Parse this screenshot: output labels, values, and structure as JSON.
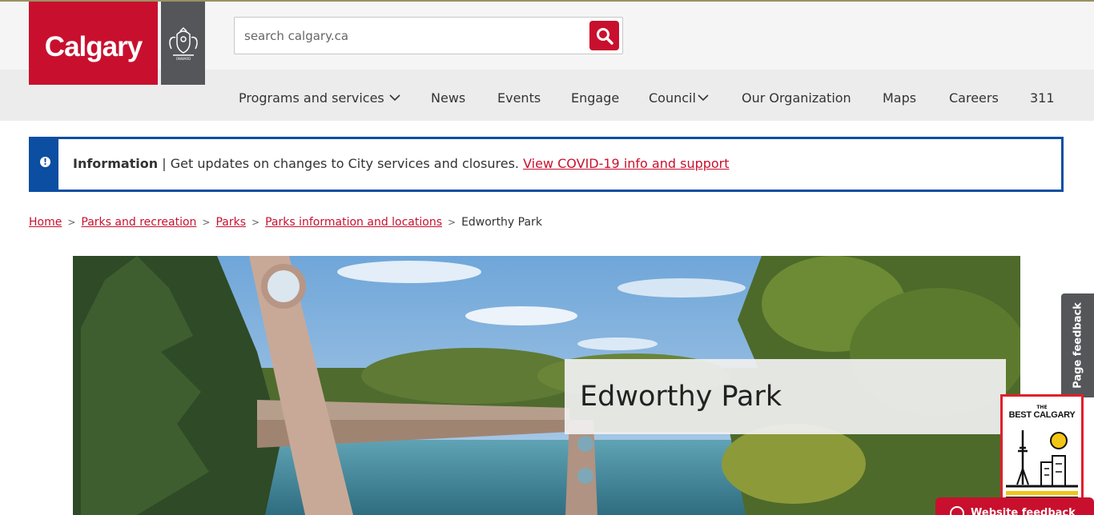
{
  "header": {
    "logo_text": "Calgary",
    "crest_alt": "City of Calgary crest",
    "search": {
      "placeholder": "search calgary.ca"
    }
  },
  "nav": {
    "items": [
      {
        "label": "Programs and services",
        "has_dropdown": true
      },
      {
        "label": "News",
        "has_dropdown": false
      },
      {
        "label": "Events",
        "has_dropdown": false
      },
      {
        "label": "Engage",
        "has_dropdown": false
      },
      {
        "label": "Council",
        "has_dropdown": true
      },
      {
        "label": "Our Organization",
        "has_dropdown": false
      },
      {
        "label": "Maps",
        "has_dropdown": false
      },
      {
        "label": "Careers",
        "has_dropdown": false
      },
      {
        "label": "311",
        "has_dropdown": false
      }
    ]
  },
  "info_banner": {
    "icon": "exclamation-icon",
    "heading": "Information",
    "separator": "|",
    "message": "Get updates on changes to City services and closures.",
    "link_text": "View COVID-19 info and support"
  },
  "breadcrumb": {
    "links": [
      "Home",
      "Parks and recreation",
      "Parks",
      "Parks information and locations"
    ],
    "current": "Edworthy Park"
  },
  "hero": {
    "title": "Edworthy Park"
  },
  "page_feedback": {
    "label": "Page feedback"
  },
  "best_badge": {
    "the": "THE",
    "best": "BEST CALGARY"
  },
  "website_feedback": {
    "label": "Website feedback"
  },
  "colors": {
    "brand_red": "#c8102e",
    "info_blue": "#0b4ea2",
    "crest_gray": "#55565a"
  }
}
